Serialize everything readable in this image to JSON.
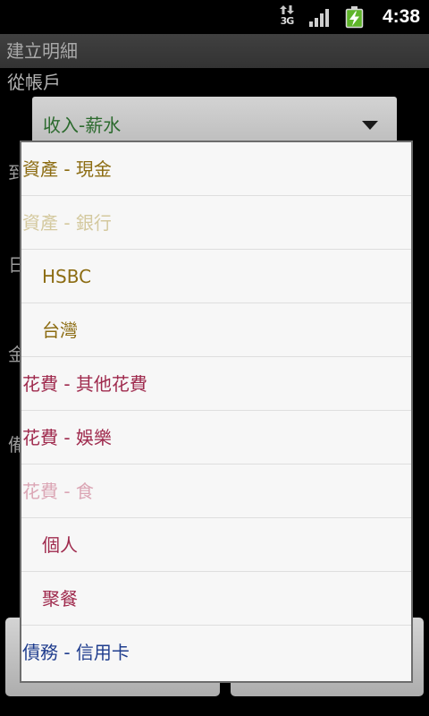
{
  "status_bar": {
    "network_type": "3G",
    "time": "4:38",
    "icons": {
      "data": "3g-data-icon",
      "signal": "signal-strength-icon",
      "battery": "battery-charging-icon"
    }
  },
  "title_bar": {
    "title": "建立明細"
  },
  "form": {
    "from_account_label": "從帳戶",
    "from_account_value": "收入-薪水",
    "from_account_value_color": "#2b6a2d",
    "dropdown_icon": "dropdown-arrow-icon",
    "obscured_labels": [
      "到",
      "日",
      "金",
      "備"
    ]
  },
  "dropdown": {
    "items": [
      {
        "label": "資產 - 現金",
        "level": 0,
        "enabled": true,
        "color": "#8c6c12"
      },
      {
        "label": "資產 - 銀行",
        "level": 0,
        "enabled": false,
        "color": "#d4c99f"
      },
      {
        "label": "HSBC",
        "level": 1,
        "enabled": true,
        "color": "#8c6c12"
      },
      {
        "label": "台灣",
        "level": 1,
        "enabled": true,
        "color": "#8c6c12"
      },
      {
        "label": "花費 - 其他花費",
        "level": 0,
        "enabled": true,
        "color": "#9f2a4d"
      },
      {
        "label": "花費 - 娛樂",
        "level": 0,
        "enabled": true,
        "color": "#9f2a4d"
      },
      {
        "label": "花費 - 食",
        "level": 0,
        "enabled": false,
        "color": "#dba6b5"
      },
      {
        "label": "個人",
        "level": 1,
        "enabled": true,
        "color": "#9f2a4d"
      },
      {
        "label": "聚餐",
        "level": 1,
        "enabled": true,
        "color": "#9f2a4d"
      },
      {
        "label": "債務 - 信用卡",
        "level": 0,
        "enabled": true,
        "color": "#1f3d8e"
      }
    ]
  }
}
